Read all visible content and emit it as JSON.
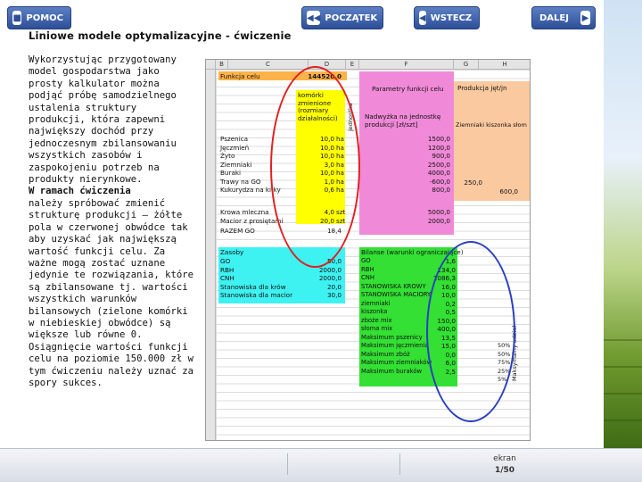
{
  "slide": {
    "title": "Liniowe modele optymalizacyjne - ćwiczenie",
    "paragraph1": "Wykorzystując przygotowany model gospodarstwa jako prosty kalkulator można podjąć próbę samodzielnego ustalenia struktury produkcji, która zapewni największy dochód przy jednoczesnym zbilansowaniu wszystkich zasobów i zaspokojeniu potrzeb na produkty nierynkowe.",
    "paragraph2": "W ramach ćwiczenia",
    "paragraph3": "należy spróbować zmienić strukturę produkcji – żółte pola w czerwonej obwódce tak aby uzyskać jak największą wartość funkcji celu. Za ważne mogą zostać uznane jedynie te rozwiązania, które są zbilansowane tj. wartości wszystkich warunków bilansowych (zielone komórki w niebieskiej obwódce) są większe lub równe 0.",
    "paragraph4": "Osiągnięcie wartości funkcji celu na poziomie 150.000 zł w tym ćwiczeniu należy uznać za spory sukces."
  },
  "sheet": {
    "columns": [
      "B",
      "C",
      "D",
      "E",
      "F",
      "G",
      "H"
    ],
    "funkcja_celu_label": "Funkcja celu",
    "funkcja_celu_value": "144520,0",
    "jednostka": "jednostka",
    "komorki_label": "komórki zmienione (rozmiary działalności)",
    "parametry_label": "Parametry funkcji celu",
    "produkcja_label": "Produkcja jęt/jn",
    "nadwyzka_label": "Nadwyżka na jednostkę produkcji [zł/szt]",
    "ziemniaki_kiszonka_label": "Ziemniaki  kiszonka  słom",
    "crops": [
      {
        "name": "Pszenica",
        "value": "10,0",
        "unit": "ha",
        "param": "1500,0"
      },
      {
        "name": "Jęczmień",
        "value": "10,0",
        "unit": "ha",
        "param": "1200,0"
      },
      {
        "name": "Żyto",
        "value": "10,0",
        "unit": "ha",
        "param": "900,0"
      },
      {
        "name": "Ziemniaki",
        "value": "3,0",
        "unit": "ha",
        "param": "2500,0"
      },
      {
        "name": "Buraki",
        "value": "10,0",
        "unit": "ha",
        "param": "4000,0"
      },
      {
        "name": "Trawy na GO",
        "value": "1,0",
        "unit": "ha",
        "param": "-600,0"
      },
      {
        "name": "Kukurydza na ki-ky",
        "value": "0,6",
        "unit": "ha",
        "param": "800,0"
      }
    ],
    "peach_values": [
      "250,0",
      "600,0"
    ],
    "animals": [
      {
        "name": "Krowa mleczna",
        "value": "4,0",
        "unit": "szt",
        "param": "5000,0"
      },
      {
        "name": "Macior z prosiętami",
        "value": "20,0",
        "unit": "szt",
        "param": "2000,0"
      }
    ],
    "razem_label": "RAZEM GO",
    "razem_value": "18,4",
    "zasoby_label": "Zasoby",
    "resources": [
      {
        "name": "GO",
        "value": "50,0"
      },
      {
        "name": "RBH",
        "value": "2000,0"
      },
      {
        "name": "CNH",
        "value": "2000,0"
      },
      {
        "name": "Stanowiska dla krów",
        "value": "20,0"
      },
      {
        "name": "Stanowiska dla macior",
        "value": "30,0"
      }
    ],
    "bilanse_label": "Bilanse (warunki ograniczające)",
    "balances": [
      {
        "name": "GO",
        "value": "1,6"
      },
      {
        "name": "RBH",
        "value": "134,0"
      },
      {
        "name": "CNH",
        "value": "1086,3"
      },
      {
        "name": "STANOWISKA KROWY",
        "value": "16,0"
      },
      {
        "name": "STANOWISKA MACIORY",
        "value": "10,0"
      },
      {
        "name": "ziemniaki",
        "value": "0,2"
      },
      {
        "name": "kiszonka",
        "value": "0,5"
      },
      {
        "name": "zboże mix",
        "value": "150,0"
      },
      {
        "name": "słoma mix",
        "value": "400,0"
      },
      {
        "name": "Maksimum pszenicy",
        "value": "13,5"
      },
      {
        "name": "Maksimum jęczmienia",
        "value": "15,0"
      },
      {
        "name": "Maksimum zbóż",
        "value": "0,0"
      },
      {
        "name": "Maksimum ziemniaków",
        "value": "6,0"
      },
      {
        "name": "Maksimum buraków",
        "value": "2,5"
      }
    ],
    "side_values": [
      "50%",
      "50%",
      "75%",
      "25%",
      "5%"
    ],
    "side_label": "Maksymalny udział"
  },
  "nav": {
    "pomoc": "POMOC",
    "poczatek": "POCZĄTEK",
    "wstecz": "WSTECZ",
    "ekran_label": "ekran",
    "page": "1/50",
    "dalej": "DALEJ"
  }
}
